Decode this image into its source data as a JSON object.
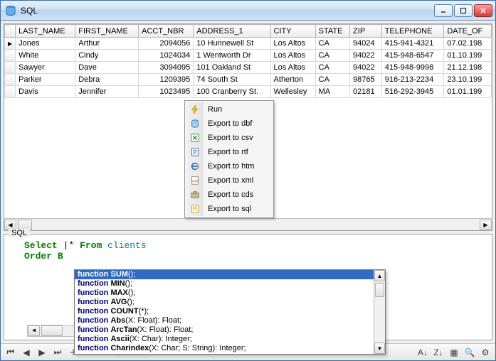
{
  "window": {
    "title": "SQL"
  },
  "win_controls": {
    "min": "–",
    "max": "▢",
    "close": "✕"
  },
  "grid": {
    "columns": [
      "LAST_NAME",
      "FIRST_NAME",
      "ACCT_NBR",
      "ADDRESS_1",
      "CITY",
      "STATE",
      "ZIP",
      "TELEPHONE",
      "DATE_OF"
    ],
    "rows": [
      {
        "last": "Jones",
        "first": "Arthur",
        "acct": "2094056",
        "addr": "10 Hunnewell St",
        "city": "Los Altos",
        "state": "CA",
        "zip": "94024",
        "tel": "415-941-4321",
        "date": "07.02.198"
      },
      {
        "last": "White",
        "first": "Cindy",
        "acct": "1024034",
        "addr": "1 Wentworth Dr",
        "city": "Los Altos",
        "state": "CA",
        "zip": "94022",
        "tel": "415-948-6547",
        "date": "01.10.199"
      },
      {
        "last": "Sawyer",
        "first": "Dave",
        "acct": "3094095",
        "addr": "101 Oakland St",
        "city": "Los Altos",
        "state": "CA",
        "zip": "94022",
        "tel": "415-948-9998",
        "date": "21.12.198"
      },
      {
        "last": "Parker",
        "first": "Debra",
        "acct": "1209395",
        "addr": "74 South St",
        "city": "Atherton",
        "state": "CA",
        "zip": "98765",
        "tel": "916-213-2234",
        "date": "23.10.199"
      },
      {
        "last": "Davis",
        "first": "Jennifer",
        "acct": "1023495",
        "addr": "100 Cranberry St.",
        "city": "Wellesley",
        "state": "MA",
        "zip": "02181",
        "tel": "516-292-3945",
        "date": "01.01.199"
      }
    ]
  },
  "context_menu": {
    "items": [
      {
        "label": "Run",
        "icon": "bolt"
      },
      {
        "label": "Export to dbf",
        "icon": "db"
      },
      {
        "label": "Export to csv",
        "icon": "xls"
      },
      {
        "label": "Export to rtf",
        "icon": "doc"
      },
      {
        "label": "Export to htm",
        "icon": "ie"
      },
      {
        "label": "Export to xml",
        "icon": "xml"
      },
      {
        "label": "Export to cds",
        "icon": "case"
      },
      {
        "label": "Export to sql",
        "icon": "sql"
      }
    ]
  },
  "sql_panel": {
    "legend": "SQL",
    "line1": {
      "select": "Select",
      "star": "*",
      "from": "From",
      "table": "clients"
    },
    "line2": {
      "order": "Order",
      "by": "B"
    }
  },
  "autocomplete": {
    "items": [
      {
        "keyword": "function",
        "sig": "SUM();",
        "sel": true
      },
      {
        "keyword": "function",
        "sig": "MIN();"
      },
      {
        "keyword": "function",
        "sig": "MAX();"
      },
      {
        "keyword": "function",
        "sig": "AVG();"
      },
      {
        "keyword": "function",
        "sig": "COUNT(*);"
      },
      {
        "keyword": "function",
        "sig": "Abs(X: Float): Float;"
      },
      {
        "keyword": "function",
        "sig": "ArcTan(X: Float): Float;"
      },
      {
        "keyword": "function",
        "sig": "Ascii(X: Char): Integer;"
      },
      {
        "keyword": "function",
        "sig": "Charindex(X: Char; S: String): Integer;"
      }
    ]
  },
  "toolbar": {
    "nav": [
      "⏮",
      "◀",
      "▶",
      "⏭",
      "＋",
      "－",
      "✔",
      "✖",
      "↻"
    ]
  }
}
